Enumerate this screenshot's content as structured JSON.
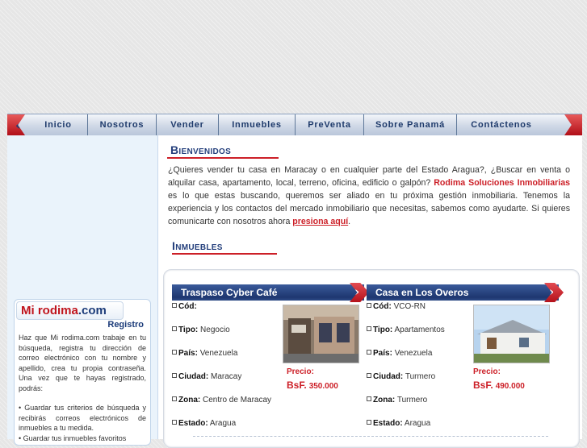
{
  "nav": {
    "items": [
      "Inicio",
      "Nosotros",
      "Vender",
      "Inmuebles",
      "PreVenta",
      "Sobre Panamá",
      "Contáctenos"
    ]
  },
  "sidebar": {
    "logo_mi": "Mi rodima",
    "logo_dom": ".com",
    "registro_title": "Registro",
    "registro_text": "Haz que Mi rodima.com trabaje en tu búsqueda, registra tu dirección de correo electrónico con tu nombre y apellido, crea tu propia contraseña. Una vez que te hayas registrado, podrás:",
    "bullet_1": "• Guardar tus criterios de búsqueda y recibirás correos electrónicos de inmuebles a tu medida.",
    "bullet_2": "• Guardar tus inmuebles favoritos"
  },
  "welcome": {
    "title": "Bienvenidos",
    "text_before": "¿Quieres vender tu casa en Maracay o en cualquier parte del Estado Aragua?, ¿Buscar en venta o alquilar casa, apartamento, local, terreno, oficina, edificio o galpón? ",
    "brand": "Rodima Soluciones Inmobiliarias",
    "text_after": " es lo que estas buscando, queremos ser aliado en tu próxima gestión inmobiliaria. Tenemos la experiencia y los contactos del mercado inmobiliario que necesitas, sabemos como ayudarte. Si quieres comunicarte con nosotros ahora ",
    "link": "presiona aquí"
  },
  "inmuebles": {
    "title": "Inmuebles",
    "labels": {
      "cod": "Cód:",
      "tipo": "Tipo:",
      "pais": "País:",
      "ciudad": "Ciudad:",
      "zona": "Zona:",
      "estado": "Estado:",
      "precio": "Precio:",
      "currency": "BsF."
    },
    "listings": [
      {
        "title": "Traspaso Cyber Café",
        "cod": "",
        "tipo": "Negocio",
        "pais": "Venezuela",
        "ciudad": "Maracay",
        "zona": "Centro de Maracay",
        "estado": "Aragua",
        "price": "350.000"
      },
      {
        "title": "Casa en Los Overos",
        "cod": "VCO-RN",
        "tipo": "Apartamentos",
        "pais": "Venezuela",
        "ciudad": "Turmero",
        "zona": "Turmero",
        "estado": "Aragua",
        "price": "490.000"
      }
    ]
  },
  "colors": {
    "accent_red": "#cc1f27",
    "navy": "#1e3770",
    "sidebar_bg": "#eaf3fb"
  }
}
